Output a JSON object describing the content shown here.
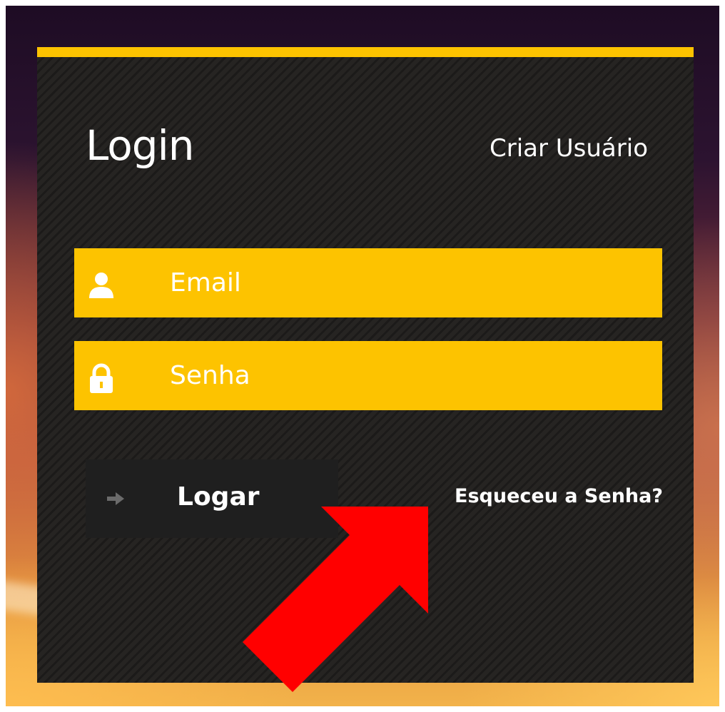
{
  "login_panel": {
    "title": "Login",
    "create_user_link": "Criar Usuário",
    "email_field": {
      "placeholder": "Email",
      "icon": "user-icon"
    },
    "password_field": {
      "placeholder": "Senha",
      "icon": "lock-icon"
    },
    "submit_button": {
      "label": "Logar",
      "icon": "arrow-right-icon"
    },
    "forgot_password_link": "Esqueceu a Senha?"
  },
  "colors": {
    "accent": "#fdc300",
    "panel": "#262422",
    "button": "#1f1f1f",
    "annotation_arrow": "#ff0000"
  }
}
